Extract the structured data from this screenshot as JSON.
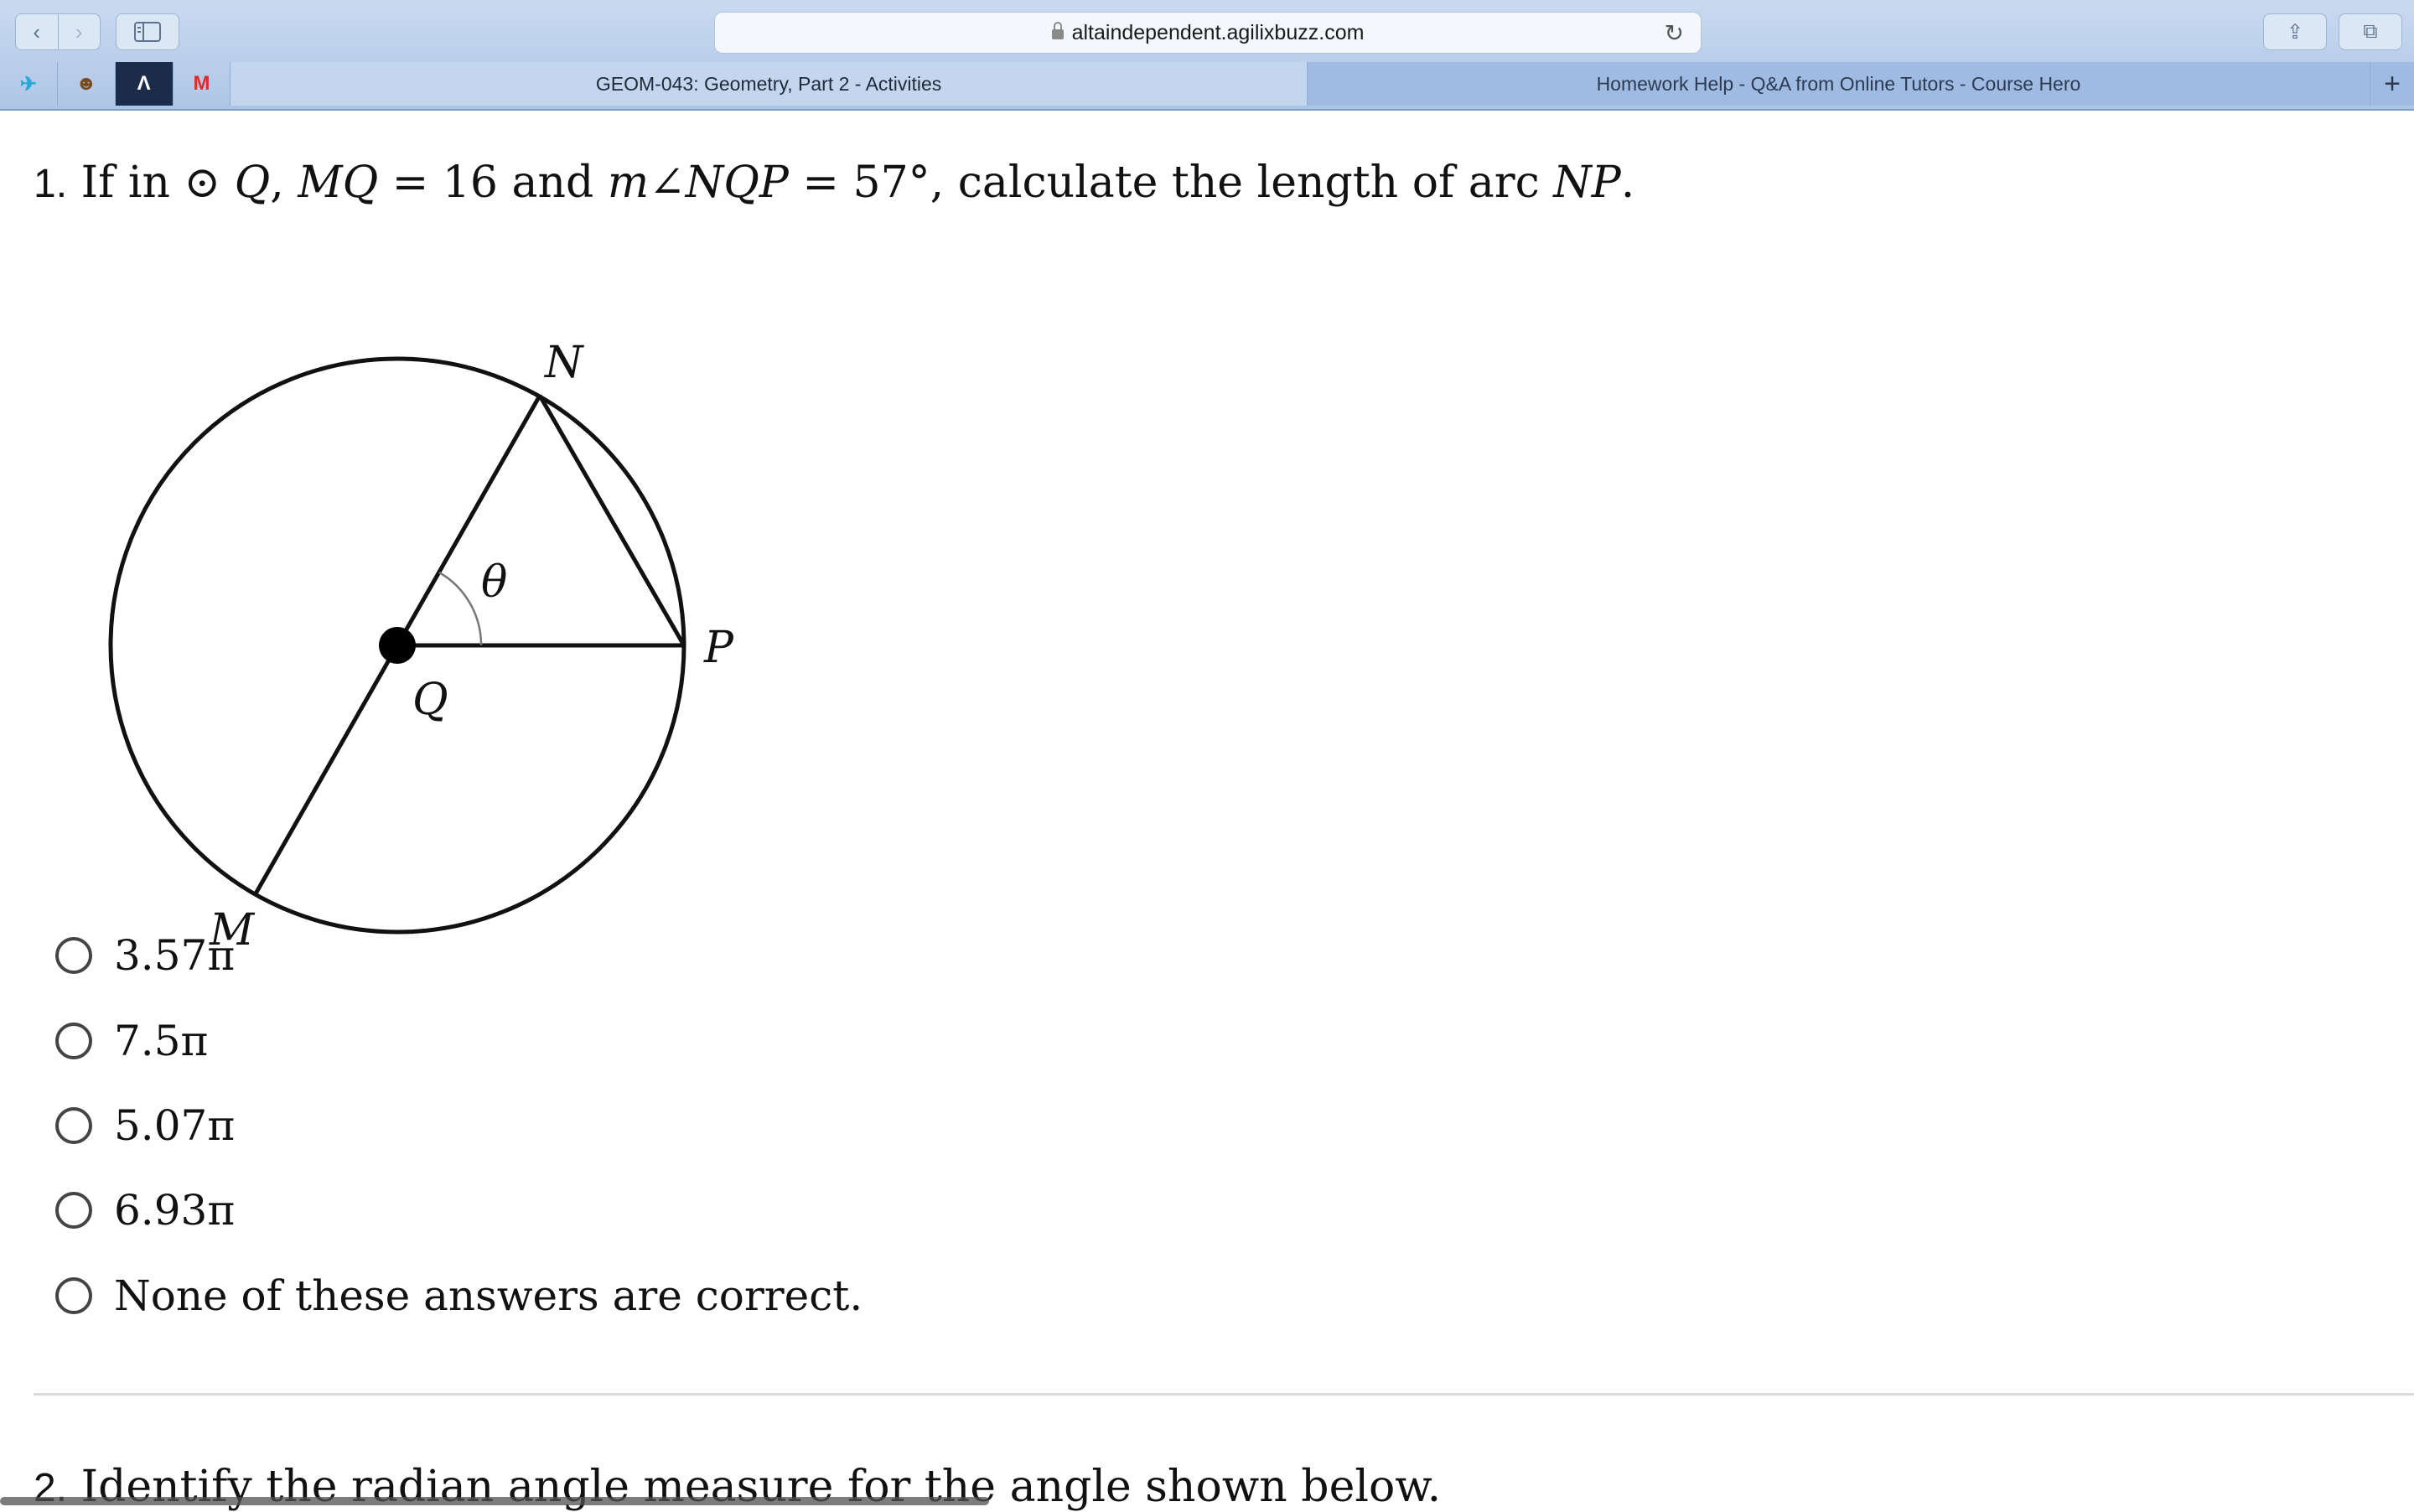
{
  "browser": {
    "url": "altaindependent.agilixbuzz.com",
    "back_glyph": "‹",
    "forward_glyph": "›",
    "tabs": [
      {
        "label": "GEOM-043: Geometry, Part 2 - Activities",
        "active": true
      },
      {
        "label": "Homework Help - Q&A from Online Tutors - Course Hero",
        "active": false
      }
    ],
    "new_tab_glyph": "+",
    "favicons": [
      "bookmark-icon",
      "owl-icon",
      "altitude-icon",
      "gmail-icon"
    ],
    "favicon_glyphs": [
      "✈",
      "☻",
      "Λ",
      "M"
    ],
    "share_glyph": "⇪",
    "tabs_glyph": "⧉",
    "reload_glyph": "↻"
  },
  "question1": {
    "number": "1.",
    "text_parts": [
      "If in ",
      "⊙",
      "Q",
      ",  ",
      "MQ",
      " = 16 and ",
      "m∠NQP",
      " = 57°, calculate the length of arc ",
      "NP",
      "."
    ],
    "diagram_labels": {
      "N": "N",
      "P": "P",
      "Q": "Q",
      "M": "M",
      "theta": "θ"
    },
    "options": [
      {
        "label": "3.57π",
        "selected": false
      },
      {
        "label": "7.5π",
        "selected": false
      },
      {
        "label": "5.07π",
        "selected": false
      },
      {
        "label": "6.93π",
        "selected": false
      },
      {
        "label": "None of these answers are correct.",
        "selected": false
      }
    ]
  },
  "question2": {
    "number": "2.",
    "text": "Identify the radian angle measure for the angle shown below."
  },
  "colors": {
    "chrome_top": "#c9daf0",
    "tab_inactive": "#9fbbe2",
    "text": "#111111"
  }
}
